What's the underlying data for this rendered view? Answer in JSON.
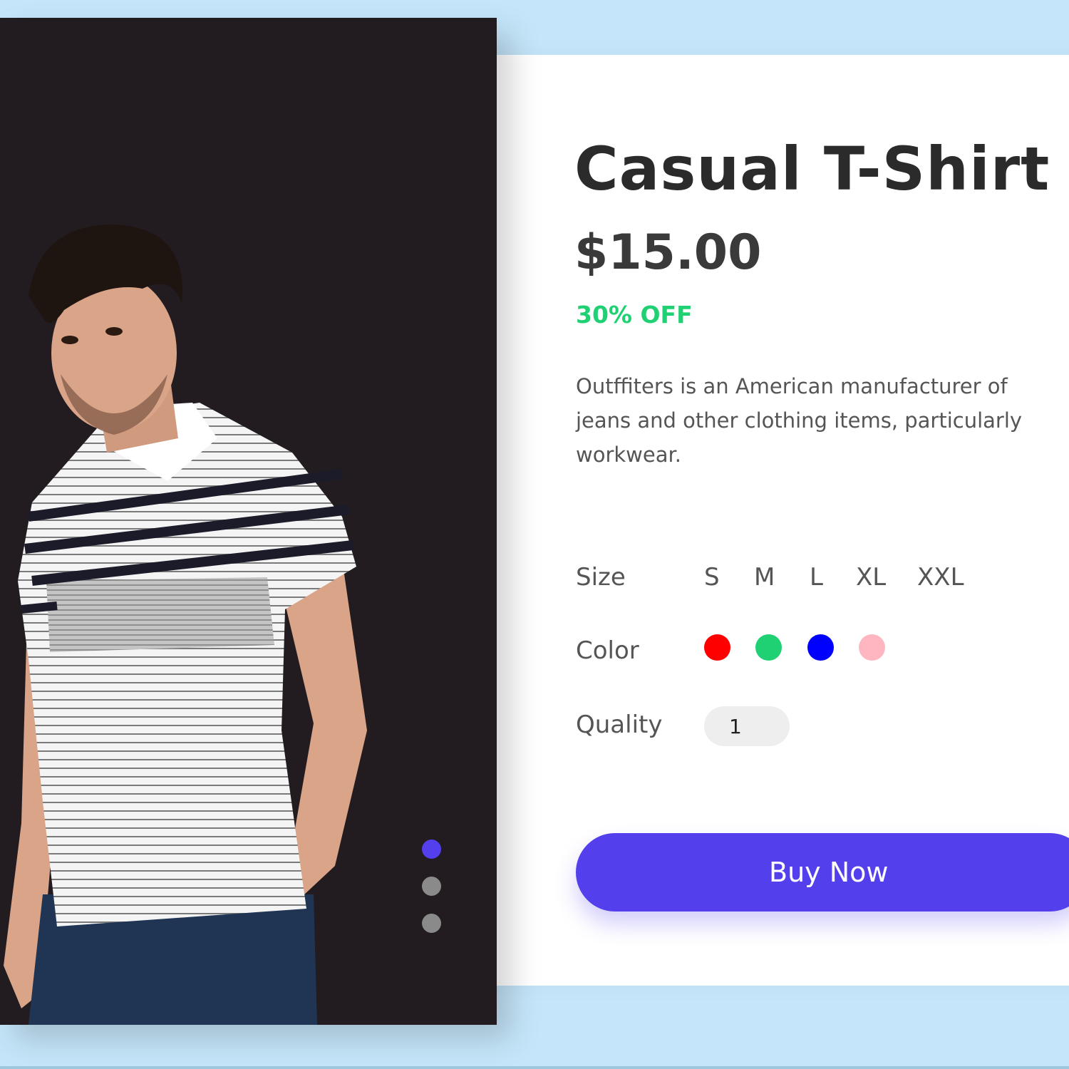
{
  "product": {
    "title": "Casual T-Shirt",
    "price": "$15.00",
    "discount": "30% OFF",
    "description": "Outffiters is an American manufacturer of jeans and other clothing items, particularly workwear."
  },
  "options": {
    "size_label": "Size",
    "sizes": [
      "S",
      "M",
      "L",
      "XL",
      "XXL"
    ],
    "color_label": "Color",
    "colors": [
      "#ff0000",
      "#1fd173",
      "#0000ff",
      "#ffb6c1"
    ],
    "quantity_label": "Quality",
    "quantity_value": "1"
  },
  "buy_button_label": "Buy Now",
  "carousel": {
    "active_color": "#5340ec",
    "inactive_color": "#8a8a8a",
    "active_index": 0,
    "count": 3
  },
  "photo_icon": "model-photo-icon"
}
